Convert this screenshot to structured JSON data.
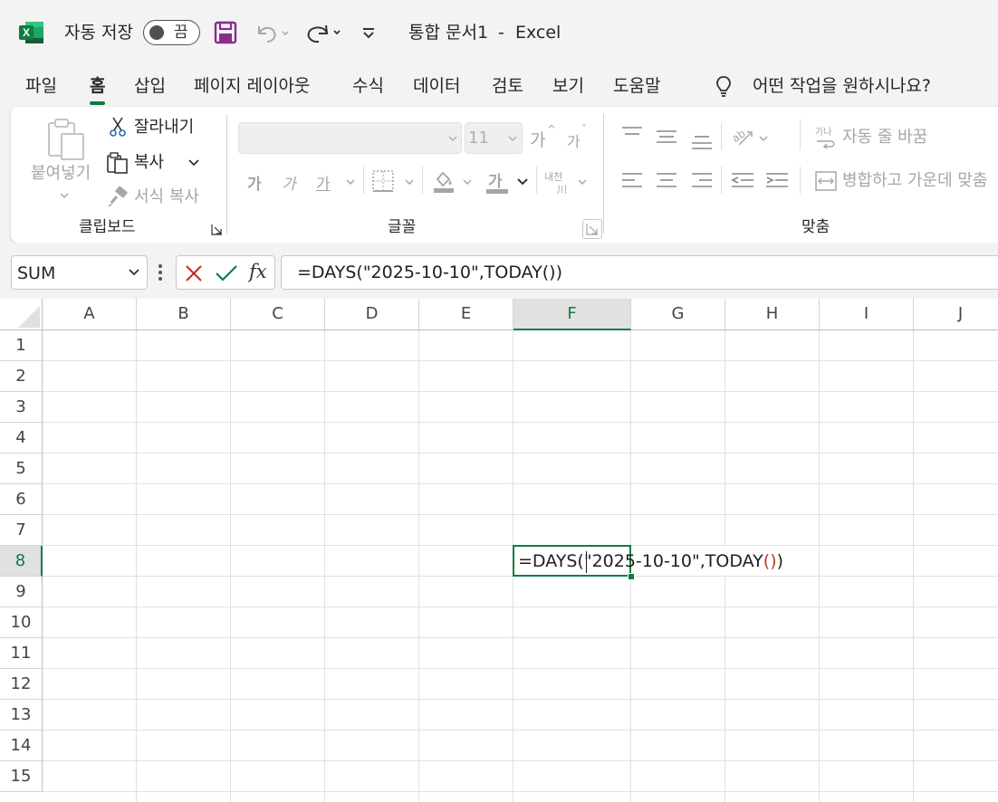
{
  "titlebar": {
    "autosave_label": "자동 저장",
    "autosave_state": "끔",
    "document_title": "통합 문서1",
    "separator": "-",
    "app_name": "Excel",
    "excel_logo_text": "X"
  },
  "menu": {
    "tabs": [
      "파일",
      "홈",
      "삽입",
      "페이지 레이아웃",
      "수식",
      "데이터",
      "검토",
      "보기",
      "도움말"
    ],
    "active_tab": "홈",
    "search_placeholder": "어떤 작업을 원하시나요?"
  },
  "ribbon": {
    "clipboard": {
      "paste": "붙여넣기",
      "cut": "잘라내기",
      "copy": "복사",
      "format_painter": "서식 복사",
      "group_name": "클립보드"
    },
    "font": {
      "font_name_value": "",
      "font_size_value": "11",
      "grow_font": "가",
      "shrink_font": "가",
      "bold": "가",
      "italic": "가",
      "underline": "가",
      "font_color": "가",
      "phonetic": "내천",
      "group_name": "글꼴"
    },
    "alignment": {
      "wrap_text": "자동 줄 바꿈",
      "merge_center": "병합하고 가운데 맞춤",
      "group_name": "맞춤"
    }
  },
  "formula_bar": {
    "name_box": "SUM",
    "fx_label": "fx",
    "formula": "=DAYS(\"2025-10-10\",TODAY())"
  },
  "grid": {
    "columns": [
      "A",
      "B",
      "C",
      "D",
      "E",
      "F",
      "G",
      "H",
      "I",
      "J"
    ],
    "rows": [
      "1",
      "2",
      "3",
      "4",
      "5",
      "6",
      "7",
      "8",
      "9",
      "10",
      "11",
      "12",
      "13",
      "14",
      "15"
    ],
    "selected_column": "F",
    "selected_row": "8",
    "active_cell": {
      "text_before_caret": "=DAYS(",
      "text_after_caret": "\"2025-10-10\",TODAY",
      "paren_open": "(",
      "paren_close": ")",
      "final_paren": ")"
    }
  },
  "colors": {
    "accent_green": "#107c41",
    "save_icon_purple": "#8a2d8a"
  }
}
